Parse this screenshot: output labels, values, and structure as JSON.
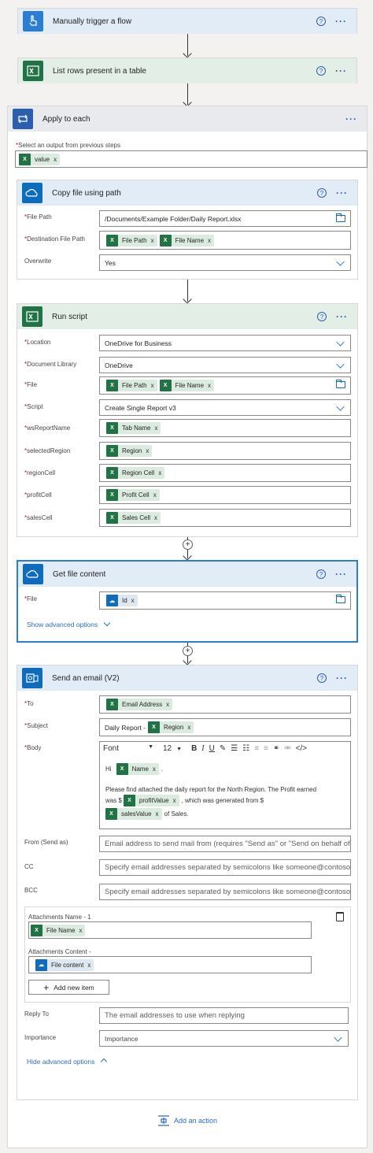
{
  "steps": {
    "trigger": {
      "title": "Manually trigger a flow"
    },
    "list_rows": {
      "title": "List rows present in a table"
    },
    "apply_each": {
      "title": "Apply to each",
      "select_label": "Select an output from previous steps",
      "select_token": "value"
    },
    "copy_file": {
      "title": "Copy file using path",
      "file_path_label": "File Path",
      "file_path_value": "/Documents/Example Folder/Daily Report.xlsx",
      "dest_label": "Destination File Path",
      "dest_tokens": [
        "File Path",
        "File Name"
      ],
      "overwrite_label": "Overwrite",
      "overwrite_value": "Yes"
    },
    "run_script": {
      "title": "Run script",
      "location_label": "Location",
      "location_value": "OneDrive for Business",
      "doclib_label": "Document Library",
      "doclib_value": "OneDrive",
      "file_label": "File",
      "file_tokens": [
        "File Path",
        "File Name"
      ],
      "script_label": "Script",
      "script_value": "Create Single Report v3",
      "ws_label": "wsReportName",
      "ws_token": "Tab Name",
      "region_label": "selectedRegion",
      "region_token": "Region",
      "regioncell_label": "regionCell",
      "regioncell_token": "Region Cell",
      "profit_label": "profitCell",
      "profit_token": "Profit Cell",
      "sales_label": "salesCell",
      "sales_token": "Sales Cell"
    },
    "get_file": {
      "title": "Get file content",
      "file_label": "File",
      "file_token": "Id",
      "advanced_link": "Show advanced options"
    },
    "send_email": {
      "title": "Send an email (V2)",
      "to_label": "To",
      "to_token": "Email Address",
      "subject_label": "Subject",
      "subject_prefix": "Daily Report -",
      "subject_token": "Region",
      "body_label": "Body",
      "font_label": "Font",
      "font_size": "12",
      "body_hi": "Hi",
      "body_name_token": "Name",
      "body_line1": "Please find attached the daily report for the North Region.  The Profit earned",
      "body_line2_prefix": "was $",
      "body_profit_token": "profitValue",
      "body_line2_suffix": ", which was generated from $",
      "body_sales_token": "salesValue",
      "body_line3_suffix": "of Sales.",
      "from_label": "From (Send as)",
      "from_placeholder": "Email address to send mail from (requires \"Send as\" or \"Send on behalf of\" permission)",
      "cc_label": "CC",
      "cc_placeholder": "Specify email addresses separated by semicolons like someone@contoso.com",
      "bcc_label": "BCC",
      "bcc_placeholder": "Specify email addresses separated by semicolons like someone@contoso.com",
      "att_name_label": "Attachments Name - 1",
      "att_name_token": "File Name",
      "att_content_label": "Attachments Content -",
      "att_content_index": "1",
      "att_content_token": "File content",
      "add_item_label": "Add new item",
      "reply_label": "Reply To",
      "reply_placeholder": "The email addresses to use when replying",
      "importance_label": "Importance",
      "importance_value": "Importance",
      "hide_link": "Hide advanced options"
    }
  },
  "add_action": "Add an action",
  "help_glyph": "?",
  "more_glyph": "···",
  "required_mark": "*",
  "remove_glyph": "x",
  "colors": {
    "accent": "#2b7cd3",
    "excel": "#217346",
    "required": "#c50f1f"
  }
}
